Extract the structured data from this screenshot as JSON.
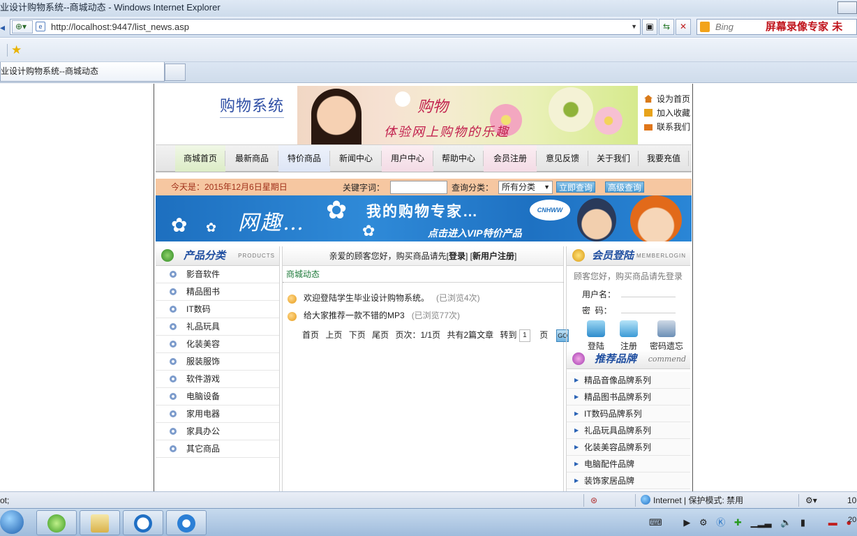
{
  "browser": {
    "window_title": "业设计购物系统--商城动态 - Windows Internet Explorer",
    "url": "http://localhost:9447/list_news.asp",
    "search_placeholder": "Bing",
    "overlay_text": "屏幕录像专家  未",
    "tab_title": "业设计购物系统--商城动态"
  },
  "site": {
    "logo_text": "购物系统",
    "hero": {
      "title1": "购物",
      "title2": "体验网上购物的乐趣"
    },
    "quick_links": [
      "设为首页",
      "加入收藏",
      "联系我们"
    ],
    "nav": [
      "商城首页",
      "最新商品",
      "特价商品",
      "新闻中心",
      "用户中心",
      "帮助中心",
      "会员注册",
      "意见反馈",
      "关于我们",
      "我要充值"
    ],
    "searchbar": {
      "date": "今天是：2015年12月6日星期日",
      "keyword_label": "关键字词：",
      "keyword_value": "",
      "category_label": "查询分类：",
      "category_selected": "所有分类",
      "search_button": "立即查询",
      "advanced_button": "高级查询"
    },
    "banner": {
      "left_text": "网趣…",
      "big_text": "我的购物专家…",
      "small_text": "点击进入VIP特价产品",
      "cloud_text": "CNHWW"
    },
    "left": {
      "title": "产品分类",
      "subtitle": "PRODUCTS",
      "categories": [
        "影音软件",
        "精品图书",
        "IT数码",
        "礼品玩具",
        "化装美容",
        "服装服饰",
        "软件游戏",
        "电脑设备",
        "家用电器",
        "家具办公",
        "其它商品"
      ]
    },
    "middle": {
      "welcome_prefix": "亲爱的顾客您好，购买商品请先[",
      "login_link": "登录",
      "welcome_mid": "] [",
      "register_link": "新用户注册",
      "welcome_suffix": "]",
      "section_title": "商城动态",
      "news": [
        {
          "title": "欢迎登陆学生毕业设计购物系统。",
          "views": "(已浏览4次)"
        },
        {
          "title": "给大家推荐一款不错的MP3",
          "views": "(已浏览77次)"
        }
      ],
      "pager": {
        "first": "首页",
        "prev": "上页",
        "next": "下页",
        "last": "尾页",
        "pages": "页次：1/1页",
        "total": "共有2篇文章",
        "goto": "转到",
        "page_input": "1",
        "page_unit": "页",
        "go_button": "GO"
      }
    },
    "right": {
      "login_title": "会员登陆",
      "login_subtitle": "MEMBERLOGIN",
      "login_hint": "顾客您好，购买商品请先登录",
      "username_label": "用户名：",
      "password_label": "密  码：",
      "buttons": [
        "登陆",
        "注册",
        "密码遗忘"
      ],
      "brand_title": "推荐品牌",
      "brand_subtitle": "commend",
      "brands": [
        "精品音像品牌系列",
        "精品图书品牌系列",
        "IT数码品牌系列",
        "礼品玩具品牌系列",
        "化装美容品牌系列",
        "电脑配件品牌",
        "装饰家居品牌"
      ]
    }
  },
  "statusbar": {
    "left_text": "ot;",
    "zone": "Internet | 保护模式: 禁用",
    "zoom": "10"
  },
  "taskbar": {
    "clock": "20"
  },
  "colors": {
    "accent_blue": "#1f4ea0",
    "search_bar_bg": "#f6c7a1",
    "news_green": "#1e7a3a",
    "hero_pink": "#c2214e"
  }
}
